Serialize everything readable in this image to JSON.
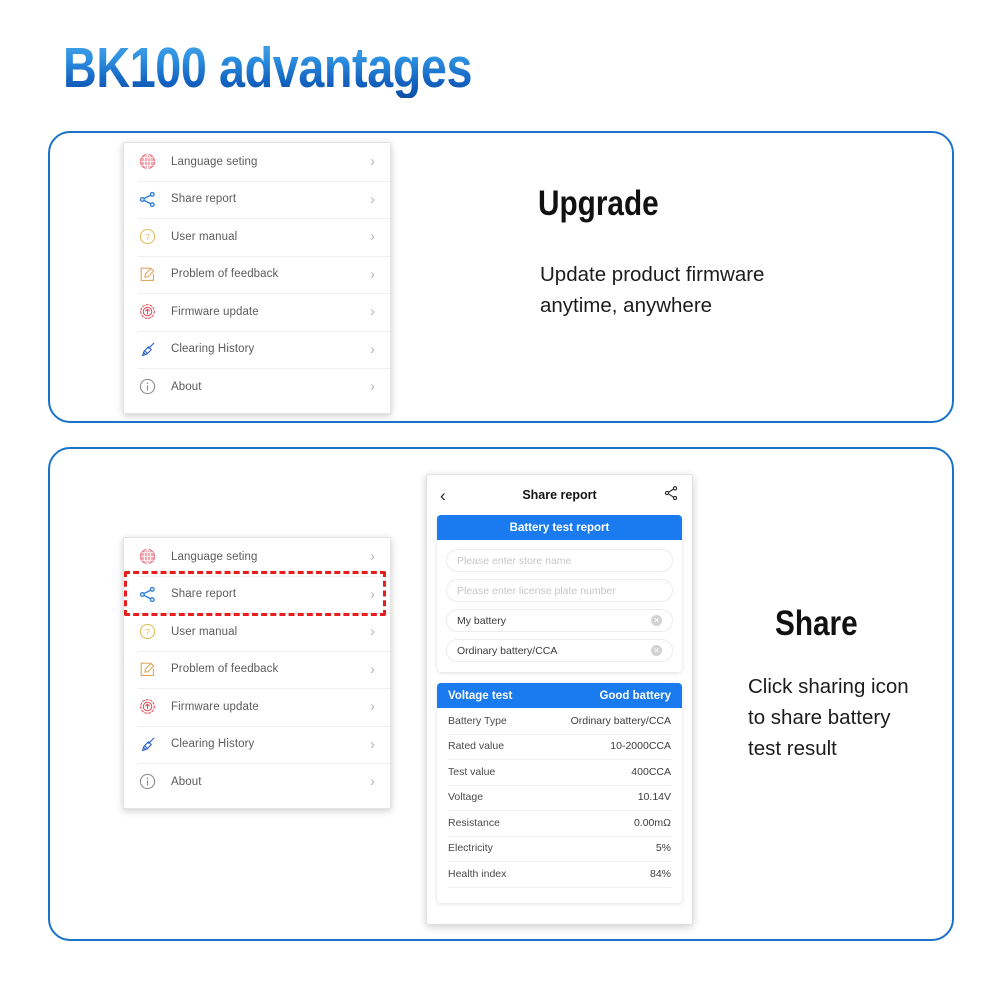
{
  "page": {
    "title": "BK100 advantages",
    "title_gradient_top": "#4aa8e8",
    "title_gradient_bottom": "#0d4fa8",
    "panel_border_color": "#1a73c8",
    "accent_blue": "#1a7af0",
    "highlight_color": "#e81d1d"
  },
  "menu": {
    "items": [
      {
        "label": "Language seting",
        "icon": "globe-icon",
        "chevron": "›"
      },
      {
        "label": "Share report",
        "icon": "share-icon",
        "chevron": "›"
      },
      {
        "label": "User manual",
        "icon": "question-icon",
        "chevron": "›"
      },
      {
        "label": "Problem of feedback",
        "icon": "edit-icon",
        "chevron": "›"
      },
      {
        "label": "Firmware update",
        "icon": "update-icon",
        "chevron": "›"
      },
      {
        "label": "Clearing History",
        "icon": "broom-icon",
        "chevron": "›"
      },
      {
        "label": "About",
        "icon": "info-icon",
        "chevron": "›"
      }
    ]
  },
  "upgrade_section": {
    "headline": "Upgrade",
    "body": "Update product firmware\nanytime, anywhere"
  },
  "share_section": {
    "headline": "Share",
    "body": "Click sharing icon\nto share battery\ntest result"
  },
  "phone": {
    "header": {
      "back_icon": "‹",
      "title": "Share report",
      "share_icon": "share-icon"
    },
    "report_title": "Battery test report",
    "fields": [
      {
        "value": "Please enter store name",
        "state": "placeholder",
        "clearable": false
      },
      {
        "value": "Please enter license plate number",
        "state": "placeholder",
        "clearable": false
      },
      {
        "value": "My battery",
        "state": "filled",
        "clearable": true,
        "clear_glyph": "✕"
      },
      {
        "value": "Ordinary battery/CCA",
        "state": "filled",
        "clearable": true,
        "clear_glyph": "✕"
      }
    ],
    "results": {
      "header_left": "Voltage test",
      "header_right": "Good battery",
      "rows": [
        {
          "label": "Battery Type",
          "value": "Ordinary battery/CCA"
        },
        {
          "label": "Rated value",
          "value": "10-2000CCA"
        },
        {
          "label": "Test value",
          "value": "400CCA"
        },
        {
          "label": "Voltage",
          "value": "10.14V"
        },
        {
          "label": "Resistance",
          "value": "0.00mΩ"
        },
        {
          "label": "Electricity",
          "value": "5%"
        },
        {
          "label": "Health index",
          "value": "84%"
        }
      ]
    }
  }
}
